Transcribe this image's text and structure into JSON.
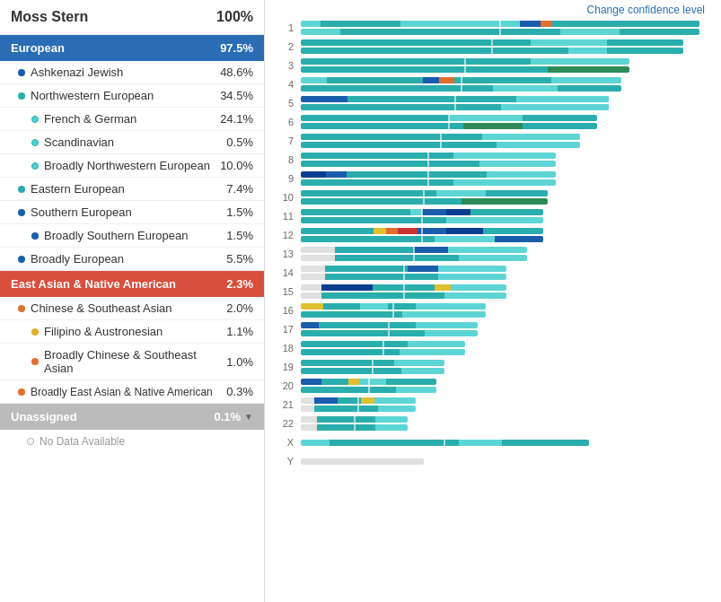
{
  "header": {
    "name": "Moss Stern",
    "percent": "100%",
    "change_confidence": "Change confidence level"
  },
  "categories": [
    {
      "id": "european",
      "label": "European",
      "value": "97.5%",
      "type": "european",
      "items": [
        {
          "label": "Ashkenazi Jewish",
          "value": "48.6%",
          "dot": "dark-blue",
          "level": 1
        },
        {
          "label": "Northwestern European",
          "value": "34.5%",
          "dot": "teal",
          "level": 1
        },
        {
          "label": "French & German",
          "value": "24.1%",
          "dot": "light-teal",
          "level": 2
        },
        {
          "label": "Scandinavian",
          "value": "0.5%",
          "dot": "light-teal",
          "level": 2
        },
        {
          "label": "Broadly Northwestern European",
          "value": "10.0%",
          "dot": "light-teal",
          "level": 2
        },
        {
          "label": "Eastern European",
          "value": "7.4%",
          "dot": "teal",
          "level": 1
        },
        {
          "label": "Southern European",
          "value": "1.5%",
          "dot": "dark-blue",
          "level": 1
        },
        {
          "label": "Broadly Southern European",
          "value": "1.5%",
          "dot": "dark-blue",
          "level": 2
        },
        {
          "label": "Broadly European",
          "value": "5.5%",
          "dot": "dark-blue",
          "level": 1
        }
      ]
    },
    {
      "id": "eastasian",
      "label": "East Asian & Native American",
      "value": "2.3%",
      "type": "eastasian",
      "items": [
        {
          "label": "Chinese & Southeast Asian",
          "value": "2.0%",
          "dot": "orange",
          "level": 1
        },
        {
          "label": "Filipino & Austronesian",
          "value": "1.1%",
          "dot": "yellow",
          "level": 2
        },
        {
          "label": "Broadly Chinese & Southeast Asian",
          "value": "1.0%",
          "dot": "orange",
          "level": 2
        },
        {
          "label": "Broadly East Asian & Native American",
          "value": "0.3%",
          "dot": "orange",
          "level": 1
        }
      ]
    },
    {
      "id": "unassigned",
      "label": "Unassigned",
      "value": "0.1%",
      "type": "unassigned",
      "items": [
        {
          "label": "No Data Available",
          "value": "",
          "dot": "outline",
          "level": 1
        }
      ]
    }
  ],
  "chromosomes": [
    {
      "label": "1"
    },
    {
      "label": "2"
    },
    {
      "label": "3"
    },
    {
      "label": "4"
    },
    {
      "label": "5"
    },
    {
      "label": "6"
    },
    {
      "label": "7"
    },
    {
      "label": "8"
    },
    {
      "label": "9"
    },
    {
      "label": "10"
    },
    {
      "label": "11"
    },
    {
      "label": "12"
    },
    {
      "label": "13"
    },
    {
      "label": "14"
    },
    {
      "label": "15"
    },
    {
      "label": "16"
    },
    {
      "label": "17"
    },
    {
      "label": "18"
    },
    {
      "label": "19"
    },
    {
      "label": "20"
    },
    {
      "label": "21"
    },
    {
      "label": "22"
    },
    {
      "label": "X"
    },
    {
      "label": "Y"
    }
  ]
}
